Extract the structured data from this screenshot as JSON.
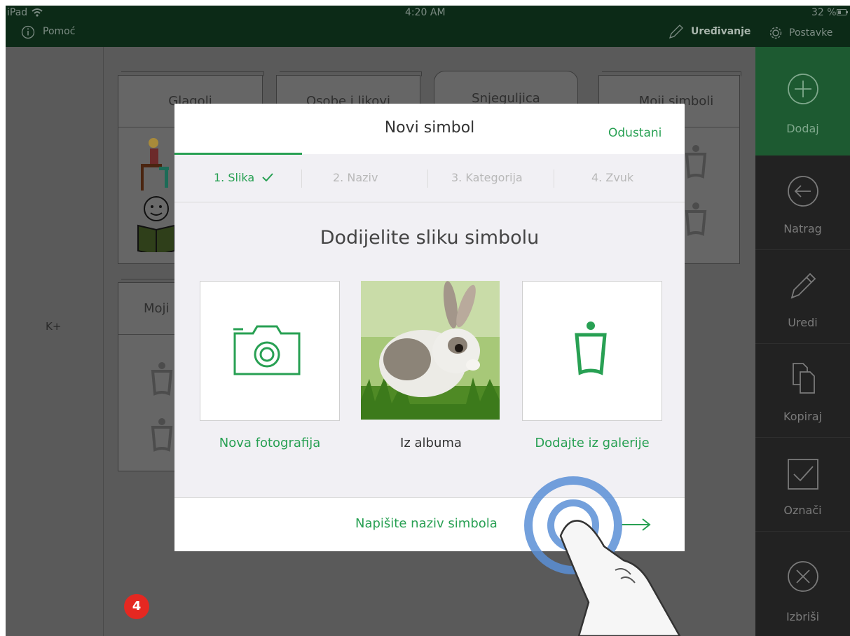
{
  "status_bar": {
    "device": "iPad",
    "time": "4:20 AM",
    "battery": "32 %",
    "help_label": "Pomoć",
    "edit_label": "Uređivanje",
    "settings_label": "Postavke"
  },
  "left_rail": {
    "label": "K+"
  },
  "categories": [
    {
      "title": "Glagoli"
    },
    {
      "title": "Osobe i likovi"
    },
    {
      "title": "Snjeguljica"
    },
    {
      "title": "Moji simboli"
    },
    {
      "title": "Moji"
    }
  ],
  "sidebar": {
    "items": [
      {
        "label": "Dodaj",
        "icon": "plus-circle-icon",
        "active": true
      },
      {
        "label": "Natrag",
        "icon": "back-arrow-icon",
        "active": false
      },
      {
        "label": "Uredi",
        "icon": "pencil-icon",
        "active": false
      },
      {
        "label": "Kopiraj",
        "icon": "copy-icon",
        "active": false
      },
      {
        "label": "Označi",
        "icon": "checkbox-icon",
        "active": false
      },
      {
        "label": "Izbriši",
        "icon": "delete-x-icon",
        "active": false
      }
    ]
  },
  "modal": {
    "title": "Novi simbol",
    "cancel_label": "Odustani",
    "steps": [
      {
        "label": "1. Slika",
        "active": true,
        "done": true
      },
      {
        "label": "2. Naziv",
        "active": false,
        "done": false
      },
      {
        "label": "3. Kategorija",
        "active": false,
        "done": false
      },
      {
        "label": "4. Zvuk",
        "active": false,
        "done": false
      }
    ],
    "heading": "Dodijelite sliku simbolu",
    "options": [
      {
        "label": "Nova fotografija",
        "icon": "camera-icon"
      },
      {
        "label": "Iz albuma",
        "icon": "album-photo"
      },
      {
        "label": "Dodajte iz galerije",
        "icon": "gallery-figure-icon"
      }
    ],
    "next_label": "Napišite naziv simbola",
    "next_icon": "arrow-right-icon"
  },
  "badge": {
    "value": "4"
  },
  "colors": {
    "accent_green": "#28a053",
    "sidebar_active": "#1d5a31",
    "status_bar": "#0c2a17",
    "badge_red": "#e52821",
    "touch_ring": "#5b8fd6"
  }
}
